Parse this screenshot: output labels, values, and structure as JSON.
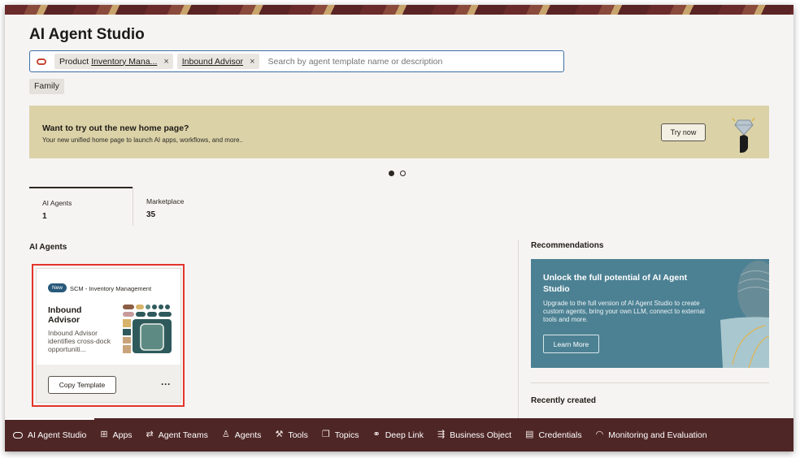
{
  "page": {
    "title": "AI Agent Studio"
  },
  "search": {
    "chips": [
      {
        "label": "Product",
        "value": "Inventory Mana...",
        "remove": "×"
      },
      {
        "label": "",
        "value": "Inbound Advisor",
        "remove": "×"
      }
    ],
    "placeholder": "Search by agent template name or description"
  },
  "filters": {
    "family_label": "Family"
  },
  "promo": {
    "title": "Want to try out the new home page?",
    "subtitle": "Your new unified home page to launch AI apps, workflows, and more..",
    "button": "Try now"
  },
  "tabs": [
    {
      "label": "AI Agents",
      "count": "1"
    },
    {
      "label": "Marketplace",
      "count": "35"
    }
  ],
  "agents_section": {
    "title": "AI Agents",
    "card": {
      "badge": "New",
      "category": "SCM - Inventory Management",
      "title": "Inbound Advisor",
      "description": "Inbound Advisor identifies cross-dock opportuniti...",
      "button": "Copy Template",
      "more": "···"
    }
  },
  "recommendations": {
    "title": "Recommendations",
    "card_title": "Unlock the full potential of AI Agent Studio",
    "card_text": "Upgrade to the full version of AI Agent Studio to create custom agents, bring your own LLM, connect to external tools and more.",
    "button": "Learn More"
  },
  "recently_created": {
    "title": "Recently created"
  },
  "bottom_nav": {
    "items": [
      {
        "label": "AI Agent Studio",
        "icon": "oval-icon"
      },
      {
        "label": "Apps",
        "icon": "apps-grid-icon",
        "glyph": "⊞"
      },
      {
        "label": "Agent Teams",
        "icon": "agent-teams-icon",
        "glyph": "⇄"
      },
      {
        "label": "Agents",
        "icon": "agents-icon",
        "glyph": "♙"
      },
      {
        "label": "Tools",
        "icon": "tools-icon",
        "glyph": "⚒"
      },
      {
        "label": "Topics",
        "icon": "topics-icon",
        "glyph": "❐"
      },
      {
        "label": "Deep Link",
        "icon": "link-icon",
        "glyph": "⚭"
      },
      {
        "label": "Business Object",
        "icon": "business-object-icon",
        "glyph": "⇶"
      },
      {
        "label": "Credentials",
        "icon": "credentials-icon",
        "glyph": "▤"
      },
      {
        "label": "Monitoring and Evaluation",
        "icon": "monitoring-icon",
        "glyph": "◠"
      }
    ]
  },
  "colors": {
    "accent_blue": "#3d6fa8",
    "brand_red": "#c74634",
    "nav_bg": "#4f2626",
    "promo_bg": "#dbd2a8",
    "recommendation_bg": "#4c8193",
    "highlight": "#e3352b"
  }
}
